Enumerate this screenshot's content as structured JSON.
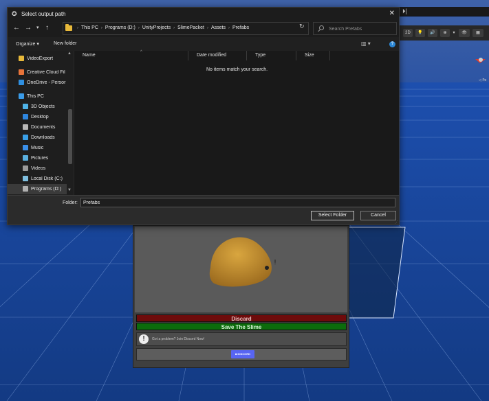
{
  "dialog": {
    "title": "Select output path",
    "close_icon": "close-icon",
    "breadcrumb": [
      "This PC",
      "Programs (D:)",
      "UnityProjects",
      "SlimePacket",
      "Assets",
      "Prefabs"
    ],
    "search_placeholder": "Search Prefabs",
    "commands": {
      "organize": "Organize ▾",
      "new_folder": "New folder"
    },
    "columns": {
      "name": "Name",
      "date": "Date modified",
      "type": "Type",
      "size": "Size"
    },
    "empty_message": "No items match your search.",
    "nav_items": [
      {
        "label": "VideoExport",
        "icon": "folder-icon",
        "color": "#e8b93a"
      },
      {
        "label": "Creative Cloud Fil",
        "icon": "creative-cloud-icon",
        "color": "#e8743a"
      },
      {
        "label": "OneDrive - Persor",
        "icon": "onedrive-icon",
        "color": "#2f8fe0"
      },
      {
        "label": "This PC",
        "icon": "computer-icon",
        "color": "#3a9be8"
      },
      {
        "label": "3D Objects",
        "icon": "cube-icon",
        "color": "#4fb3e8"
      },
      {
        "label": "Desktop",
        "icon": "desktop-icon",
        "color": "#2e86de"
      },
      {
        "label": "Documents",
        "icon": "document-icon",
        "color": "#b8b8b8"
      },
      {
        "label": "Downloads",
        "icon": "download-icon",
        "color": "#3aa0e8"
      },
      {
        "label": "Music",
        "icon": "music-icon",
        "color": "#3a8fe8"
      },
      {
        "label": "Pictures",
        "icon": "pictures-icon",
        "color": "#5ab0e0"
      },
      {
        "label": "Videos",
        "icon": "video-icon",
        "color": "#9a9a9a"
      },
      {
        "label": "Local Disk (C:)",
        "icon": "drive-icon",
        "color": "#7fbfe0"
      },
      {
        "label": "Programs (D:)",
        "icon": "drive-icon",
        "color": "#b0b0b0"
      }
    ],
    "folder_label": "Folder:",
    "folder_value": "Prefabs",
    "select_button": "Select Folder",
    "cancel_button": "Cancel"
  },
  "unity": {
    "toolbar": [
      "2D",
      "💡",
      "🔊",
      "⊕",
      "▾",
      "👁",
      "▦"
    ]
  },
  "slime_ui": {
    "discard_label": "Discard",
    "save_label": "Save The Slime",
    "problem_text": "Got a problem? Join Discord Now!",
    "discord_label": "DISCORD",
    "colors": {
      "discard": "#6e0b0b",
      "save": "#0c6c0c",
      "slime": "#c8902f",
      "discord": "#5865f2"
    }
  }
}
